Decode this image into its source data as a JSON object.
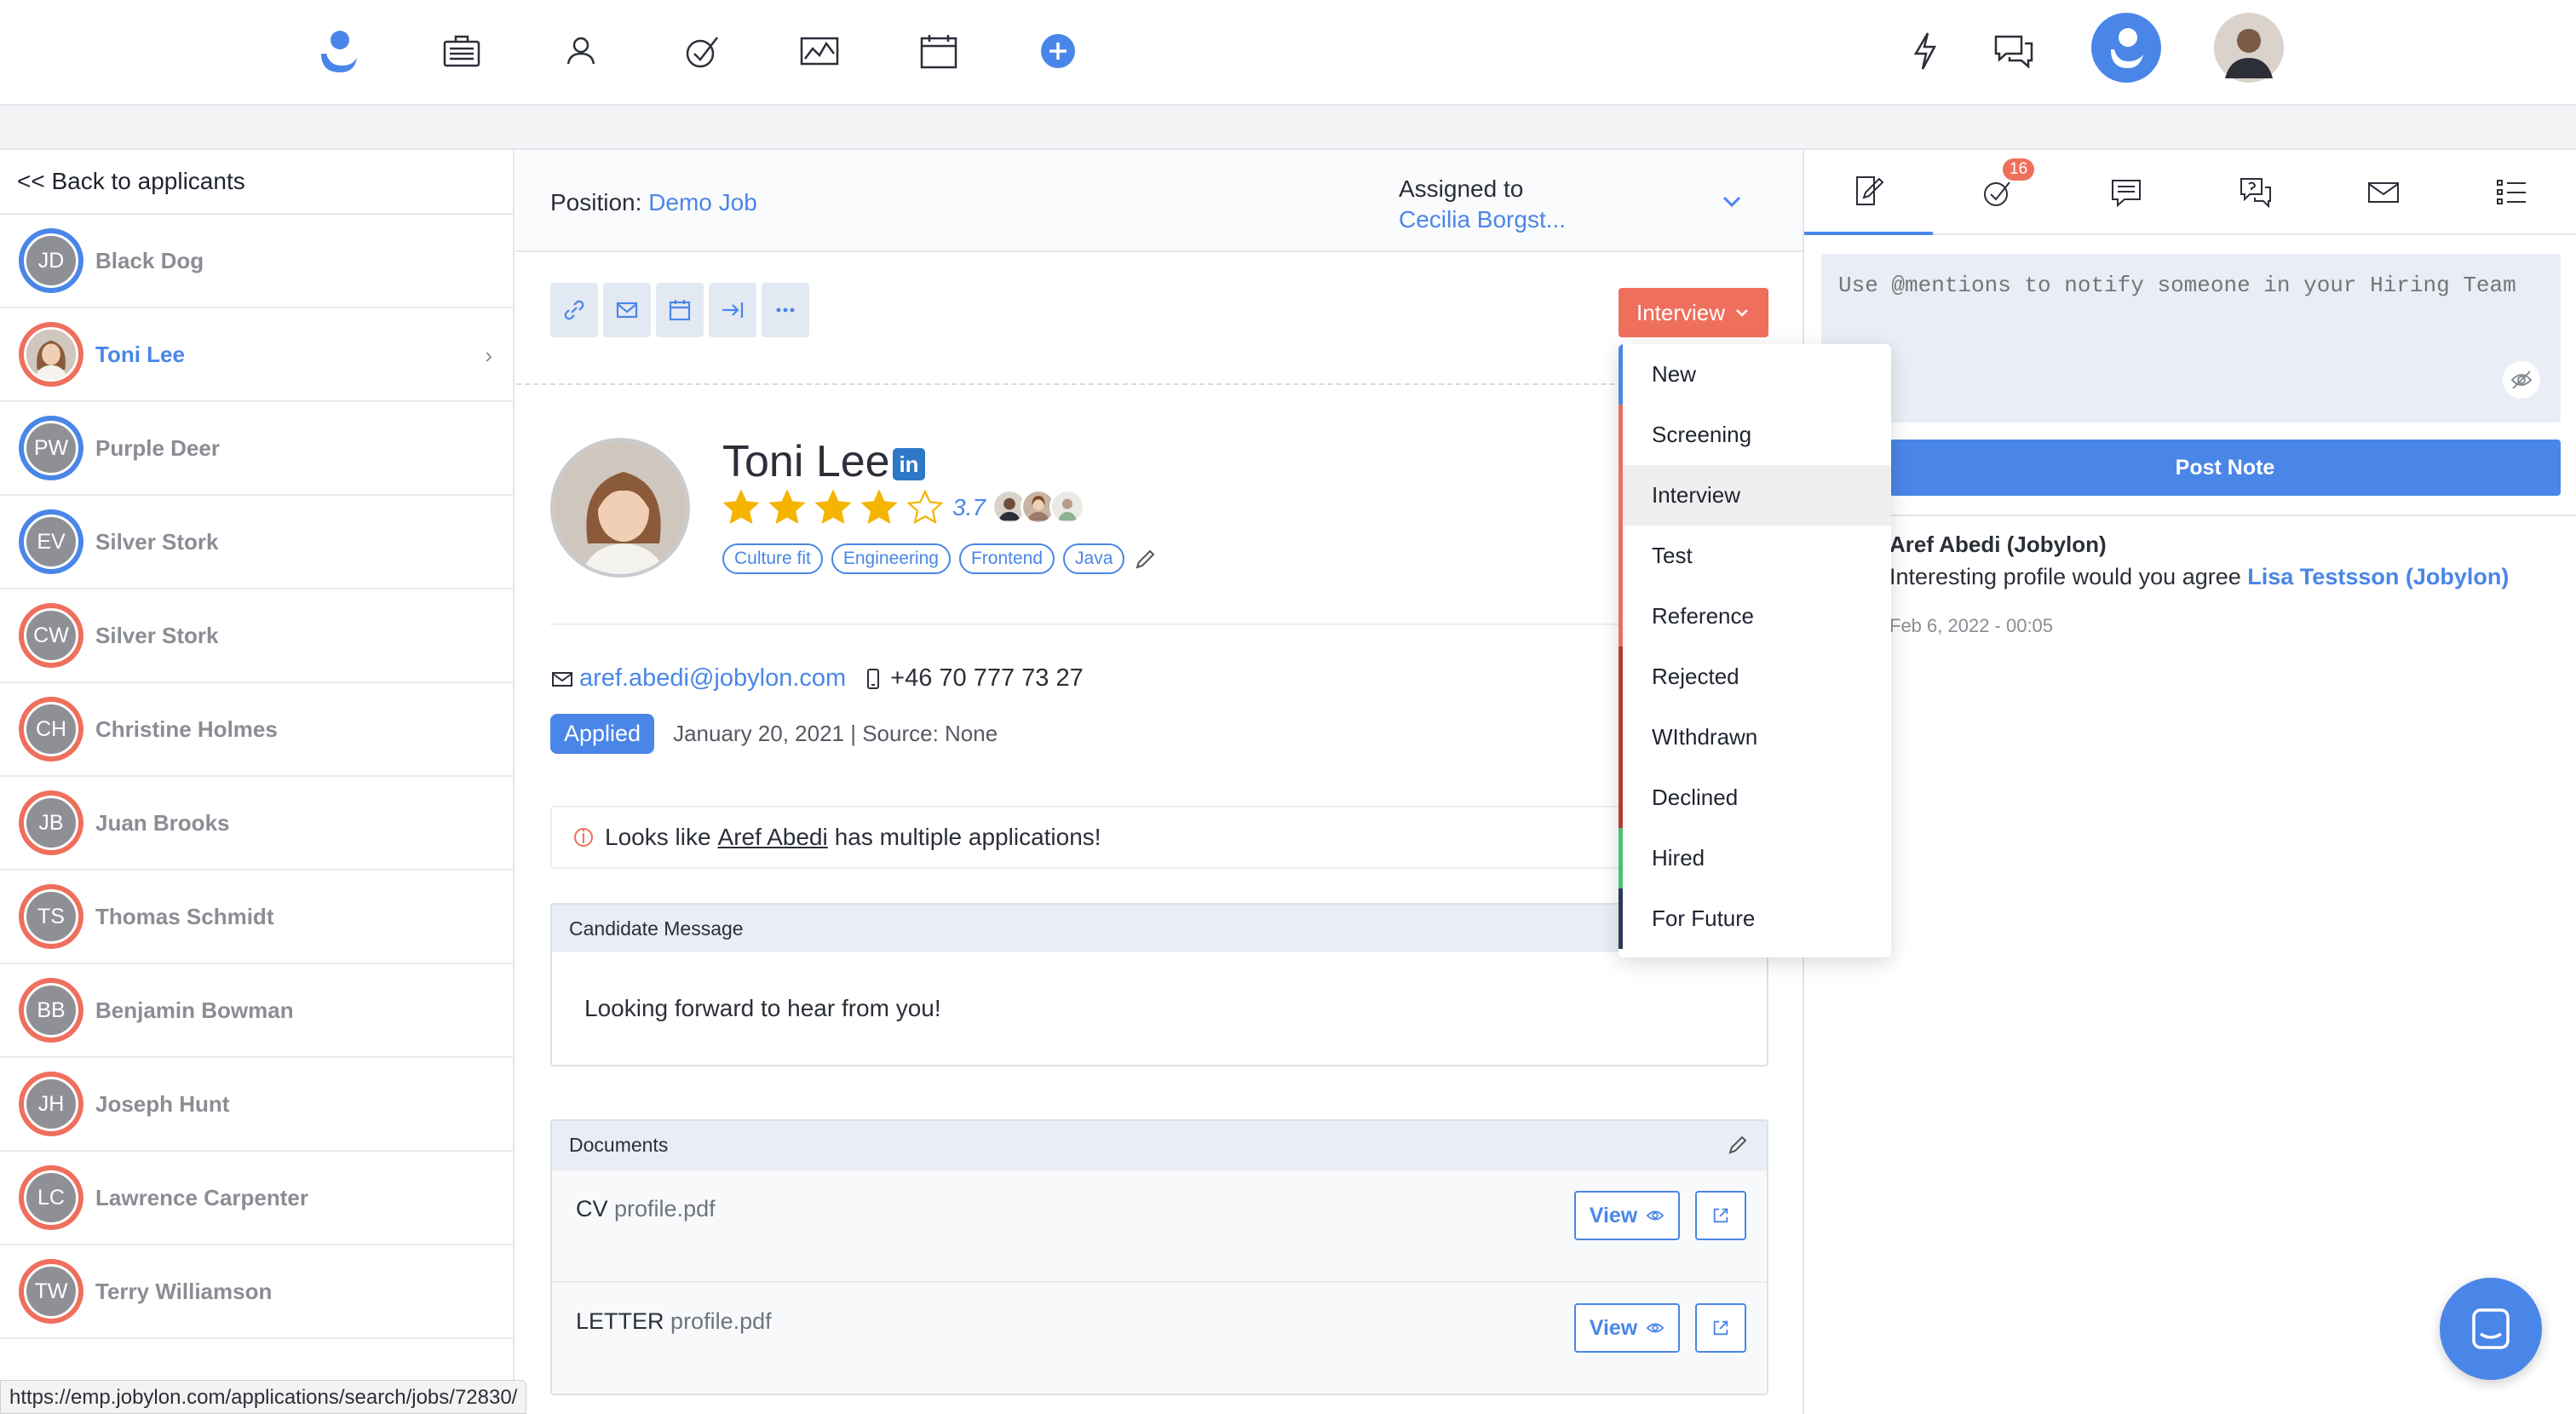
{
  "nav": {
    "icons": [
      "jobylon-logo-icon",
      "briefcase-icon",
      "person-icon",
      "check-icon",
      "chart-icon",
      "calendar-icon",
      "plus-icon",
      "lightning-icon",
      "chat-icon",
      "user-avatar-icon",
      "profile-photo"
    ]
  },
  "sidebar": {
    "back_label": "<< Back to applicants",
    "applicants": [
      {
        "initials": "JD",
        "name": "Black Dog",
        "ring": "#4a86e8"
      },
      {
        "initials": "",
        "name": "Toni Lee",
        "ring": "#ef6f5d",
        "active": true
      },
      {
        "initials": "PW",
        "name": "Purple Deer",
        "ring": "#4a86e8"
      },
      {
        "initials": "EV",
        "name": "Silver Stork",
        "ring": "#4a86e8"
      },
      {
        "initials": "CW",
        "name": "Silver Stork",
        "ring": "#ef6f5d"
      },
      {
        "initials": "CH",
        "name": "Christine Holmes",
        "ring": "#ef6f5d"
      },
      {
        "initials": "JB",
        "name": "Juan Brooks",
        "ring": "#ef6f5d"
      },
      {
        "initials": "TS",
        "name": "Thomas Schmidt",
        "ring": "#ef6f5d"
      },
      {
        "initials": "BB",
        "name": "Benjamin Bowman",
        "ring": "#ef6f5d"
      },
      {
        "initials": "JH",
        "name": "Joseph Hunt",
        "ring": "#ef6f5d"
      },
      {
        "initials": "LC",
        "name": "Lawrence Carpenter",
        "ring": "#ef6f5d"
      },
      {
        "initials": "TW",
        "name": "Terry Williamson",
        "ring": "#ef6f5d"
      }
    ]
  },
  "main": {
    "position_label": "Position:",
    "position_value": "Demo Job",
    "assigned_label": "Assigned to",
    "assigned_value": "Cecilia Borgst...",
    "stage_button": "Interview",
    "candidate": {
      "name": "Toni Lee",
      "linkedin": "in",
      "rating": "3.7",
      "stars_filled": 4,
      "stars_total": 5,
      "tags": [
        "Culture fit",
        "Engineering",
        "Frontend",
        "Java"
      ],
      "email": "aref.abedi@jobylon.com",
      "phone": "+46 70 777 73 27",
      "status_badge": "Applied",
      "applied_meta": "January 20, 2021 | Source: None"
    },
    "warning": {
      "prefix": "Looks like",
      "name": "Aref Abedi",
      "suffix": "has multiple applications!"
    },
    "message_panel": {
      "title": "Candidate Message",
      "body": "Looking forward to hear from you!"
    },
    "documents_panel": {
      "title": "Documents",
      "rows": [
        {
          "type": "CV",
          "file": "profile.pdf",
          "view": "View"
        },
        {
          "type": "LETTER",
          "file": "profile.pdf",
          "view": "View"
        }
      ]
    }
  },
  "stage_dropdown": {
    "items": [
      {
        "label": "New",
        "color": "#4a86e8"
      },
      {
        "label": "Screening",
        "color": "#ef6f5d"
      },
      {
        "label": "Interview",
        "color": "#ef6f5d",
        "hover": true
      },
      {
        "label": "Test",
        "color": "#ef6f5d"
      },
      {
        "label": "Reference",
        "color": "#ef6f5d"
      },
      {
        "label": "Rejected",
        "color": "#b83a30"
      },
      {
        "label": "WIthdrawn",
        "color": "#b83a30"
      },
      {
        "label": "Declined",
        "color": "#b83a30"
      },
      {
        "label": "Hired",
        "color": "#4cc07a"
      },
      {
        "label": "For Future",
        "color": "#2b3a55"
      }
    ]
  },
  "right_panel": {
    "tasks_badge": "16",
    "note_placeholder": "Use @mentions to notify someone in your Hiring Team",
    "post_button": "Post Note",
    "note": {
      "author": "Aref Abedi (Jobylon)",
      "text": "Interesting profile would you agree",
      "mention": "Lisa Testsson (Jobylon)",
      "date": "Feb 6, 2022 - 00:05"
    }
  },
  "statusbar": {
    "url": "https://emp.jobylon.com/applications/search/jobs/72830/"
  },
  "colors": {
    "accent": "#4a86e8",
    "stage_red": "#ef6f5d",
    "star_gold": "#f4b400"
  }
}
